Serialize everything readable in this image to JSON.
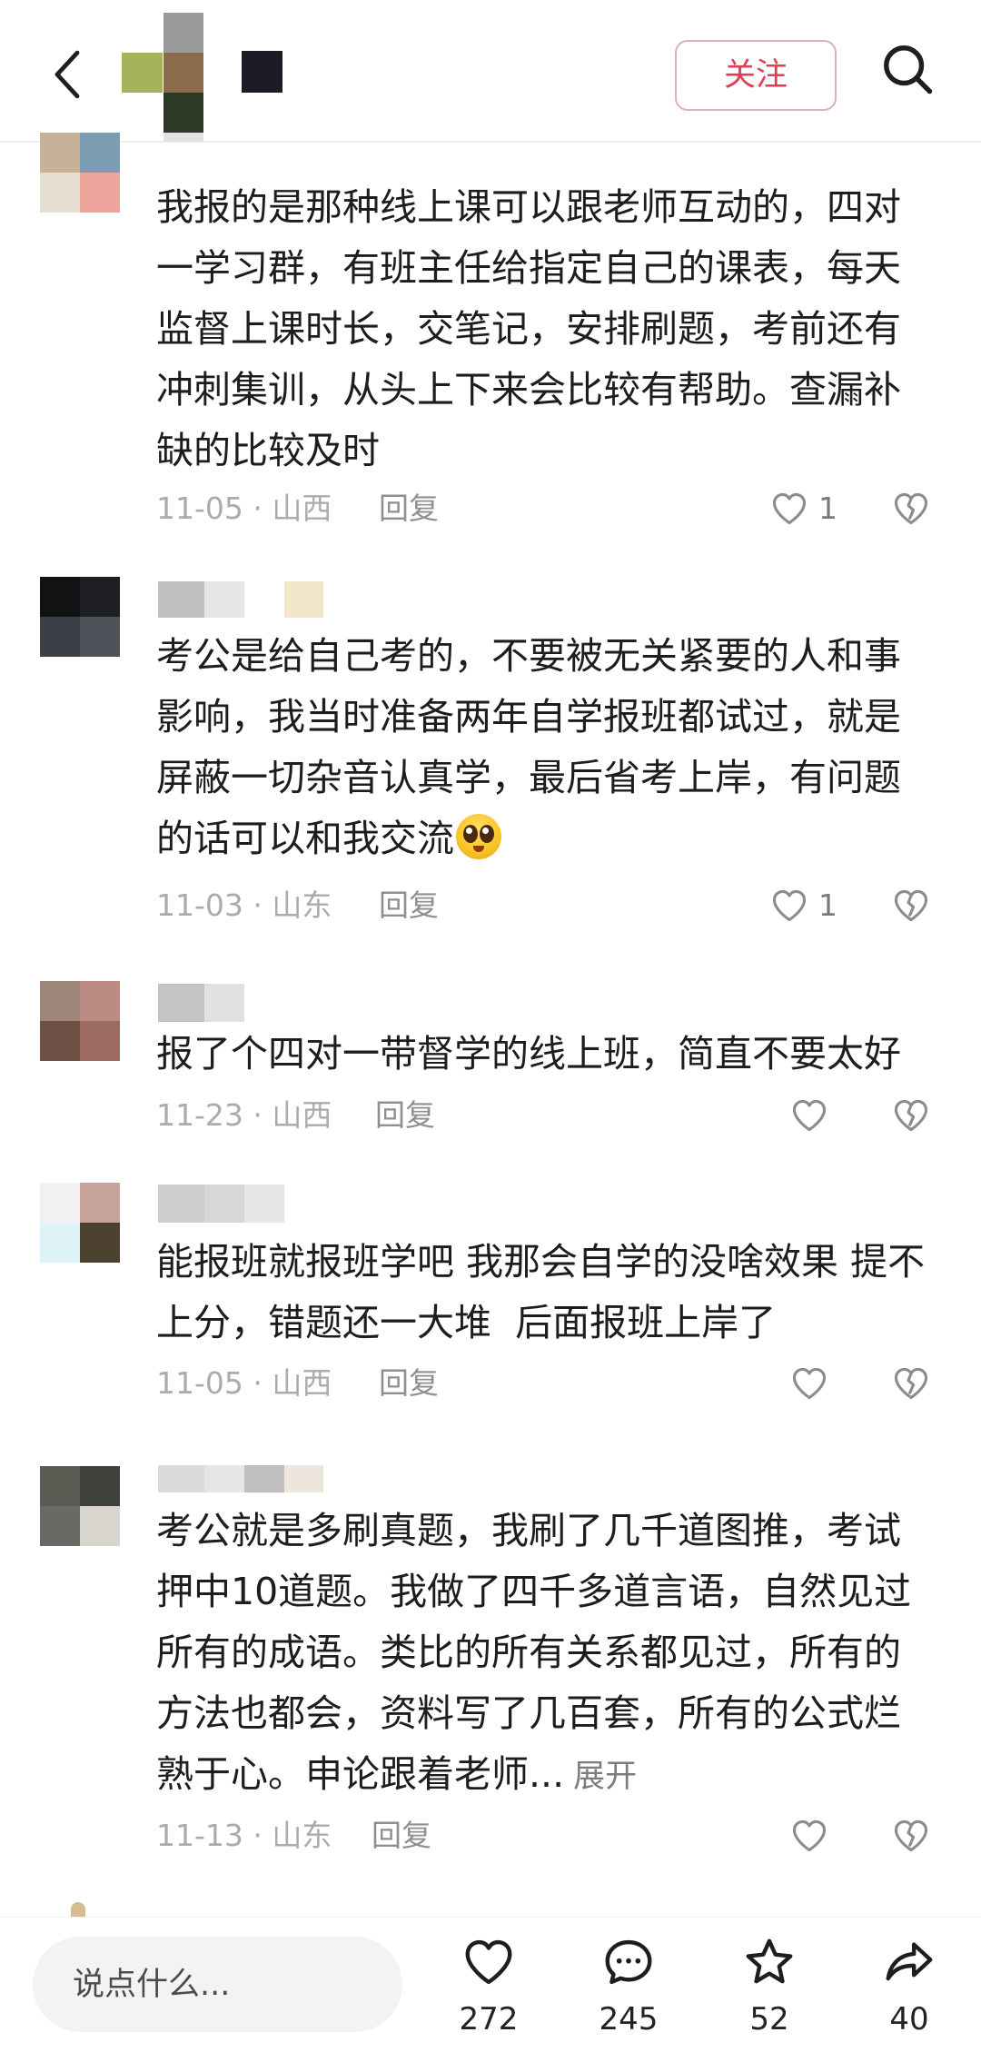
{
  "header": {
    "back_icon": "back-arrow-icon",
    "follow_label": "关注",
    "search_icon": "search-icon",
    "accent_color": "#e23d56"
  },
  "comments": [
    {
      "lines": [
        "我报的是那种线上课可以跟老师互动的，四对",
        "一学习群，有班主任给指定自己的课表，每天",
        "监督上课时长，交笔记，安排刷题，考前还有",
        "冲刺集训，从头上下来会比较有帮助。查漏补",
        "缺的比较及时"
      ],
      "date_location": "11-05 · 山西",
      "reply_label": "回复",
      "like_count": "1"
    },
    {
      "lines": [
        "考公是给自己考的，不要被无关紧要的人和事",
        "影响，我当时准备两年自学报班都试过，就是",
        "屏蔽一切杂音认真学，最后省考上岸，有问题",
        "的话可以和我交流"
      ],
      "emoji_icon": "starry-eyes-emoji",
      "date_location": "11-03 · 山东",
      "reply_label": "回复",
      "like_count": "1"
    },
    {
      "lines": [
        "报了个四对一带督学的线上班，简直不要太好"
      ],
      "date_location": "11-23 · 山西",
      "reply_label": "回复"
    },
    {
      "lines": [
        "能报班就报班学吧 我那会自学的没啥效果 提不",
        "上分，错题还一大堆  后面报班上岸了"
      ],
      "date_location": "11-05 · 山西",
      "reply_label": "回复"
    },
    {
      "lines": [
        "考公就是多刷真题，我刷了几千道图推，考试",
        "押中10道题。我做了四千多道言语，自然见过",
        "所有的成语。类比的所有关系都见过，所有的",
        "方法也都会，资料写了几百套，所有的公式烂",
        "熟于心。申论跟着老师..."
      ],
      "expand_label": "展开",
      "date_location": "11-13 · 山东",
      "reply_label": "回复"
    }
  ],
  "comment_input": {
    "placeholder": "说点什么..."
  },
  "actions": {
    "like": {
      "icon": "heart-icon",
      "count": "272"
    },
    "comment": {
      "icon": "comment-bubble-icon",
      "count": "245"
    },
    "favorite": {
      "icon": "star-icon",
      "count": "52"
    },
    "share": {
      "icon": "share-arrow-icon",
      "count": "40"
    }
  }
}
